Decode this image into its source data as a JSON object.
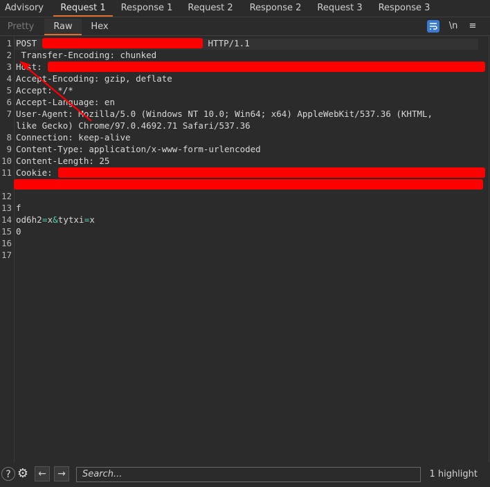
{
  "tabs": [
    "Advisory",
    "Request 1",
    "Response 1",
    "Request 2",
    "Response 2",
    "Request 3",
    "Response 3"
  ],
  "active_tab": "Request 1",
  "view_tabs": [
    "Pretty",
    "Raw",
    "Hex"
  ],
  "active_view_tab": "Raw",
  "toolbar": {
    "newline_label": "\\n",
    "wrap_icon": "wrap-lines-icon",
    "menu_icon": "hamburger-menu-icon"
  },
  "lines": [
    {
      "n": "1",
      "parts": [
        {
          "t": "POST "
        },
        {
          "redact": true
        },
        {
          "t": " HTTP/1.1"
        }
      ]
    },
    {
      "n": "2",
      "parts": [
        {
          "t": " Transfer-Encoding: chunked"
        }
      ]
    },
    {
      "n": "3",
      "parts": [
        {
          "t": "Host: "
        },
        {
          "redact": true
        }
      ]
    },
    {
      "n": "4",
      "parts": [
        {
          "t": "Accept-Encoding: gzip, deflate"
        }
      ]
    },
    {
      "n": "5",
      "parts": [
        {
          "t": "Accept: */*"
        }
      ]
    },
    {
      "n": "6",
      "parts": [
        {
          "t": "Accept-Language: en"
        }
      ]
    },
    {
      "n": "7",
      "parts": [
        {
          "t": "User-Agent: Mozilla/5.0 (Windows NT 10.0; Win64; x64) AppleWebKit/537.36 (KHTML,"
        }
      ]
    },
    {
      "n": "",
      "parts": [
        {
          "t": "like Gecko) Chrome/97.0.4692.71 Safari/537.36"
        }
      ]
    },
    {
      "n": "8",
      "parts": [
        {
          "t": "Connection: keep-alive"
        }
      ]
    },
    {
      "n": "9",
      "parts": [
        {
          "t": "Content-Type: application/x-www-form-urlencoded"
        }
      ]
    },
    {
      "n": "10",
      "parts": [
        {
          "t": "Content-Length: 25"
        }
      ]
    },
    {
      "n": "11",
      "parts": [
        {
          "t": "Cookie: "
        },
        {
          "redact": true
        }
      ]
    },
    {
      "n": "",
      "parts": [
        {
          "redact": true
        }
      ]
    },
    {
      "n": "12",
      "parts": []
    },
    {
      "n": "13",
      "parts": [
        {
          "t": "f"
        }
      ]
    },
    {
      "n": "14",
      "parts": [
        {
          "t": "od6h2"
        },
        {
          "t": "=",
          "teal": true
        },
        {
          "t": "x"
        },
        {
          "t": "&",
          "teal": true
        },
        {
          "t": "tytxi"
        },
        {
          "t": "=",
          "teal": true
        },
        {
          "t": "x"
        }
      ]
    },
    {
      "n": "15",
      "parts": [
        {
          "t": "0"
        }
      ]
    },
    {
      "n": "16",
      "parts": []
    },
    {
      "n": "17",
      "parts": []
    }
  ],
  "colors": {
    "accent": "#e36d2f",
    "redaction": "#ff0000",
    "annotation_arrow": "#ff0000",
    "teal": "#54d1b3"
  },
  "footer": {
    "search_placeholder": "Search...",
    "highlight_count": "1 highlight",
    "help_icon": "help-icon",
    "settings_icon": "gear-icon",
    "back_icon": "arrow-left-icon",
    "forward_icon": "arrow-right-icon"
  }
}
